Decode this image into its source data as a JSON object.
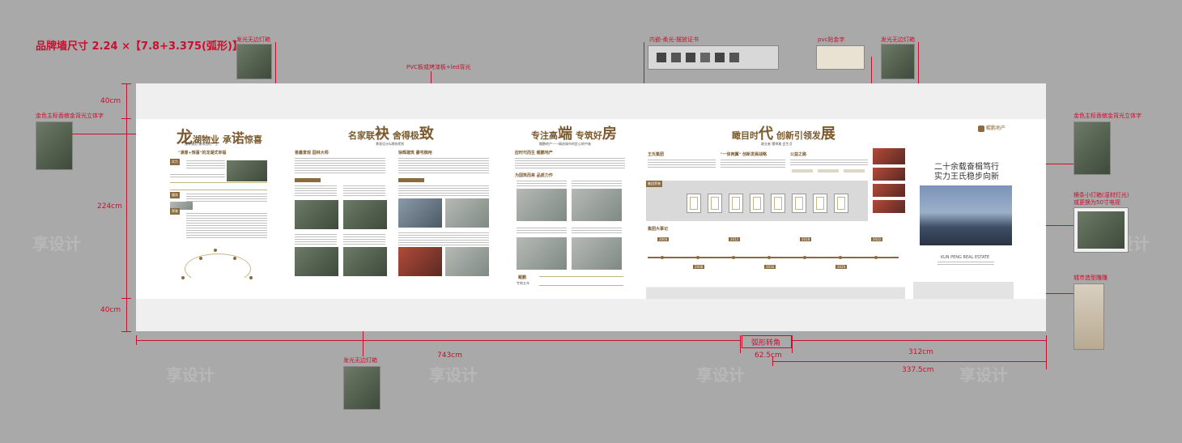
{
  "header_title": "品牌墙尺寸 2.24 ×【7.8+3.375(弧形)】",
  "labels": {
    "glow_lightbox_top": "发光无边灯箱",
    "pvc_board": "PVC板或烤漆板+led背光",
    "recessed_cert": "内嵌-柔光-摆放证书",
    "pvc_gold": "pvc贴金字",
    "glow_lightbox_right": "发光无边灯箱",
    "gold_logo_left": "金色主标香槟金背光立体字",
    "gold_logo_right": "金色主标香槟金背光立体字",
    "small_lightbox_line1": "横条小灯箱(湿材灯光)",
    "small_lightbox_line2": "或更换为50寸电视",
    "city_relief": "城市造型雕雕",
    "glow_lightbox_bottom": "发光无边灯箱",
    "arc_corner": "弧形转角"
  },
  "dimensions": {
    "top_band": "40cm",
    "middle": "224cm",
    "bottom_band": "40cm",
    "width_left": "743cm",
    "arc": "62.5cm",
    "width_right": "312cm",
    "width_total_right": "337.5cm"
  },
  "panels": {
    "p1_title_a": "龙",
    "p1_title_b": "湖物业 承",
    "p1_title_c": "诺",
    "p1_title_d": "惊喜",
    "p1_sub": "臻享服务 惠得您的一生",
    "p1_section": "\"满意+惊喜\"的龙湖式幸福",
    "p1_tag1": "实力",
    "p1_tag2": "服务",
    "p1_tag3": "荣誉",
    "p2_title_a": "名家联",
    "p2_title_b": "袂",
    "p2_title_c": " 舍得极",
    "p2_title_d": "致",
    "p2_sub": "景观设计&建筑规划",
    "p2_sec_a": "善鑫景观 园林大师",
    "p2_sec_b": "徐辉建筑 豪宅御用",
    "p3_title_a": "专注高",
    "p3_title_b": "端",
    "p3_title_c": " 专筑好",
    "p3_title_d": "房",
    "p3_sub": "鲲鹏地产——精选城市的匠心筑中者",
    "p3_sec_a": "应时代而生 鲲鹏地产",
    "p3_sec_b": "为国筑而来 品质力作",
    "p3_badge_a": "鲲鹏",
    "p3_badge_b": "专筑五年",
    "p4_title_a": "瞰目时",
    "p4_title_b": "代",
    "p4_title_c": " 创新引领发",
    "p4_title_d": "展",
    "p4_sub": "敢业者 懂审美 会生活",
    "p4_sec_a": "王氏集团",
    "p4_sec_b": "\"一体两翼\" 创新发展战略",
    "p4_sec_c": "公益之路",
    "p4_honor": "集团荣誉",
    "p4_events": "集团大事记",
    "p5_logo": "鲲鹏地产",
    "p5_slogan_1": "二十余载奋楫笃行",
    "p5_slogan_2": "实力王氏稳步向新",
    "p5_en": "KUN PENG REAL ESTATE"
  },
  "timeline_years_top": [
    "2004",
    "2008",
    "2012",
    "2016",
    "2018",
    "2020",
    "2022"
  ],
  "watermark": "享设计"
}
